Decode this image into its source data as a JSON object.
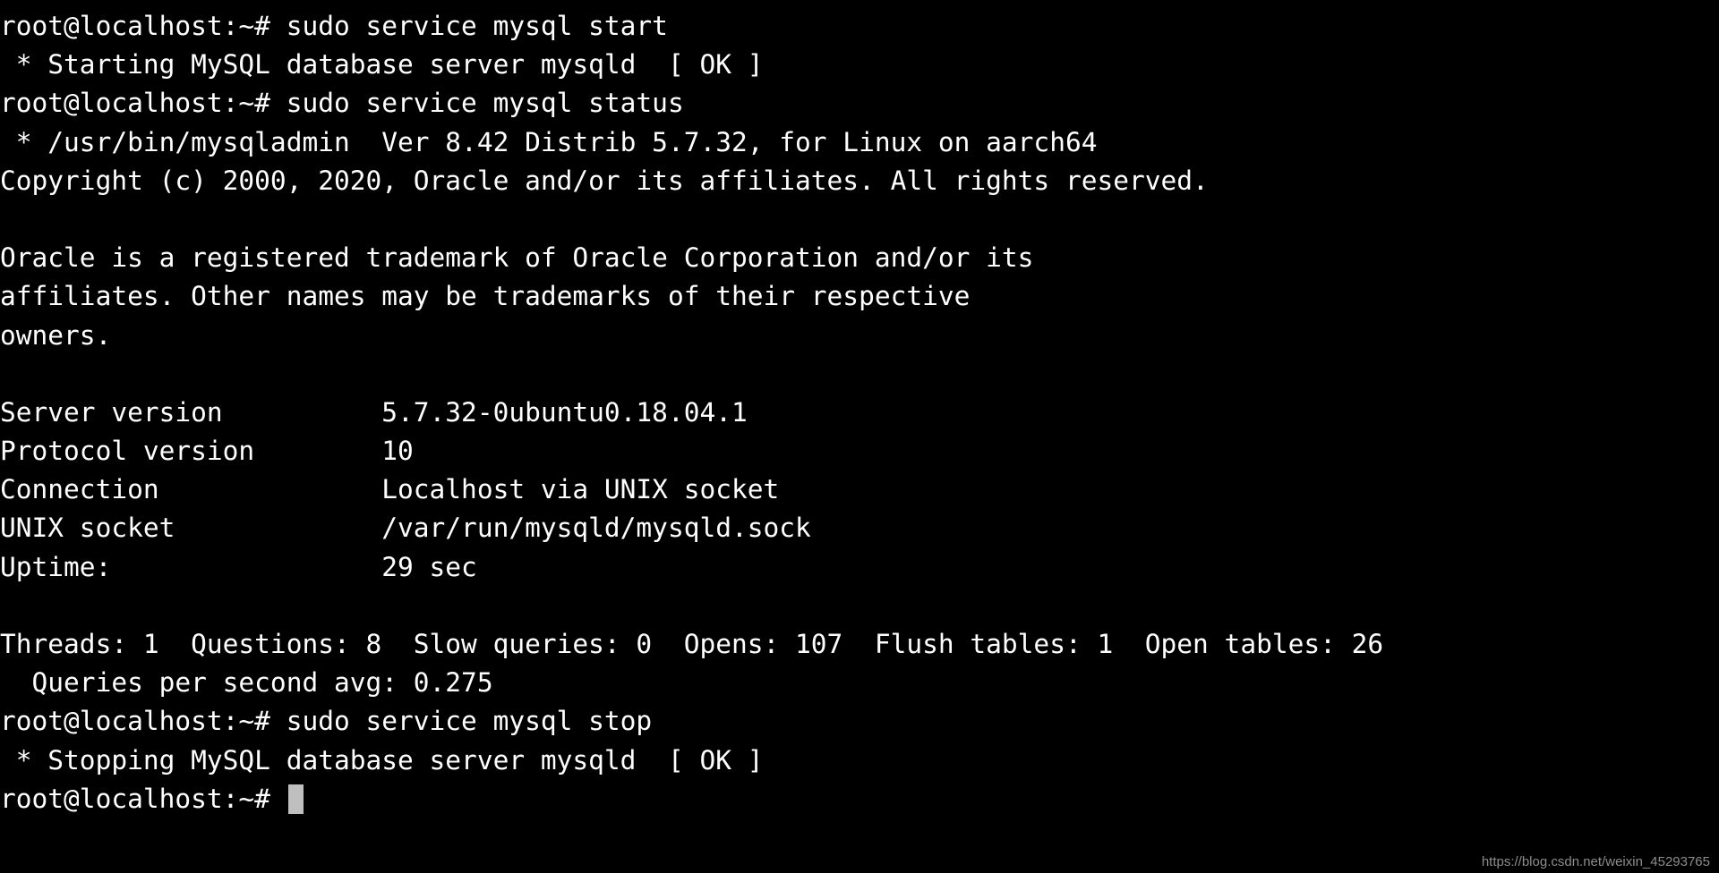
{
  "terminal": {
    "background_color": "#000000",
    "foreground_color": "#ffffff",
    "cursor_color": "#bfbfbf",
    "lines": [
      "root@localhost:~# sudo service mysql start",
      " * Starting MySQL database server mysqld  [ OK ]",
      "root@localhost:~# sudo service mysql status",
      " * /usr/bin/mysqladmin  Ver 8.42 Distrib 5.7.32, for Linux on aarch64",
      "Copyright (c) 2000, 2020, Oracle and/or its affiliates. All rights reserved.",
      "",
      "Oracle is a registered trademark of Oracle Corporation and/or its",
      "affiliates. Other names may be trademarks of their respective",
      "owners.",
      "",
      "Server version          5.7.32-0ubuntu0.18.04.1",
      "Protocol version        10",
      "Connection              Localhost via UNIX socket",
      "UNIX socket             /var/run/mysqld/mysqld.sock",
      "Uptime:                 29 sec",
      "",
      "Threads: 1  Questions: 8  Slow queries: 0  Opens: 107  Flush tables: 1  Open tables: 26",
      "  Queries per second avg: 0.275",
      "root@localhost:~# sudo service mysql stop",
      " * Stopping MySQL database server mysqld  [ OK ]"
    ],
    "prompt": "root@localhost:~# ",
    "cursor_symbol": "block-cursor",
    "status_values": {
      "start_result": "[ OK ]",
      "stop_result": "[ OK ]",
      "mysqladmin_path": "/usr/bin/mysqladmin",
      "mysqladmin_ver": "8.42",
      "distrib": "5.7.32",
      "platform": "Linux",
      "arch": "aarch64",
      "copyright_years": "2000, 2020",
      "server_version": "5.7.32-0ubuntu0.18.04.1",
      "protocol_version": "10",
      "connection": "Localhost via UNIX socket",
      "unix_socket": "/var/run/mysqld/mysqld.sock",
      "uptime": "29 sec",
      "threads": "1",
      "questions": "8",
      "slow_queries": "0",
      "opens": "107",
      "flush_tables": "1",
      "open_tables": "26",
      "queries_per_second_avg": "0.275"
    }
  },
  "watermark": {
    "text": "https://blog.csdn.net/weixin_45293765",
    "color": "#8d8d8d"
  }
}
